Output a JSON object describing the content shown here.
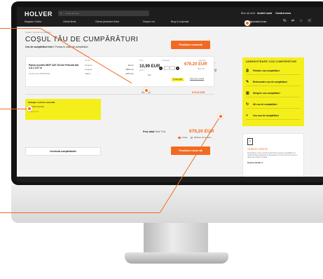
{
  "header": {
    "logo": "HOLVER",
    "search_placeholder": "Caută produse...",
    "account_prefix": "Bine ați venit",
    "account_name": "Andrei Lazăr",
    "account_link": "Contul meu",
    "nav": [
      "Magazin Online",
      "Clienți firme",
      "Clienți persoane fizice",
      "Despre noi",
      "Blog & Inspirație"
    ],
    "configure": "Configurează-ți ușa"
  },
  "main": {
    "breadcrumb": "Acasă / Coș de cumpărături",
    "title": "COȘUL TĂU DE CUMPĂRĂTURI",
    "cart_name": "Coș de cumpărături test",
    "cart_count": "1 Produs în coșul de cumpărături",
    "finalize_button": "Finalizare comandă",
    "columns": {
      "product": "",
      "details": "Detalii",
      "price": "Preț",
      "qty": "Cantitate",
      "total": "Subtotal"
    },
    "item": {
      "name": "Panou lucrativ MDF CAF 18 mm Peliculă Alb 2,8 x 2,07 m",
      "code": "Număr articol 9845125642",
      "dims": [
        {
          "label": "Grosime",
          "value": "18 mm"
        },
        {
          "label": "Lungime",
          "value": "2800 mm"
        },
        {
          "label": "Lățime",
          "value": "2070 mm"
        }
      ],
      "unit_price": "10,99 EUR",
      "unit_label": "per m²",
      "qty": "5",
      "unit": "Buc",
      "total": "679,20 EUR",
      "total_sub": "fără TVA",
      "stock": "În stoc (10)",
      "return": "Returnare ușoară"
    },
    "subtotal_label": "Subtotal",
    "subtotal_value": "679,20 EUR",
    "note": {
      "title": "Adaugă o notă la comandă",
      "text": "Instrucțiuni speciale",
      "link": "Adaugă notă"
    },
    "grand_total_label": "Preț total",
    "grand_total_tax": "fără TVA",
    "grand_total_value": "679,20 EUR",
    "radio_on": "Livrare",
    "radio_off": "Ridicare de la client",
    "continue_button": "Continuă cumpărăturile",
    "finalize_button_2": "Finalizare comandă"
  },
  "sidebar": {
    "title": "ADMINISTRARE COȘ CUMPĂRĂTURI",
    "items": [
      {
        "label": "Printare coș cumpărături",
        "icon": "printer-icon"
      },
      {
        "label": "Redenumire coș de cumpărături",
        "icon": "pencil-icon"
      },
      {
        "label": "Ștergere coș cumpărături",
        "icon": "trash-icon"
      },
      {
        "label": "Alt coș de cumpărături",
        "icon": "refresh-icon"
      },
      {
        "label": "Coș nou de cumpărături",
        "icon": "plus-icon"
      }
    ]
  },
  "offer": {
    "title": "CERERE OFERTĂ",
    "text": "Doriți ajutor, cereți o ofertă. Puteți trimite coșul de cumpărături ca ofertă. Echipa noastră vă contactează în cel mai scurt timp pentru a răspunde oricăror întrebări.",
    "link": "Cerere ofertă"
  },
  "colors": {
    "accent": "#f26a21",
    "highlight": "#f4ef1a",
    "header": "#1d1d1d"
  }
}
